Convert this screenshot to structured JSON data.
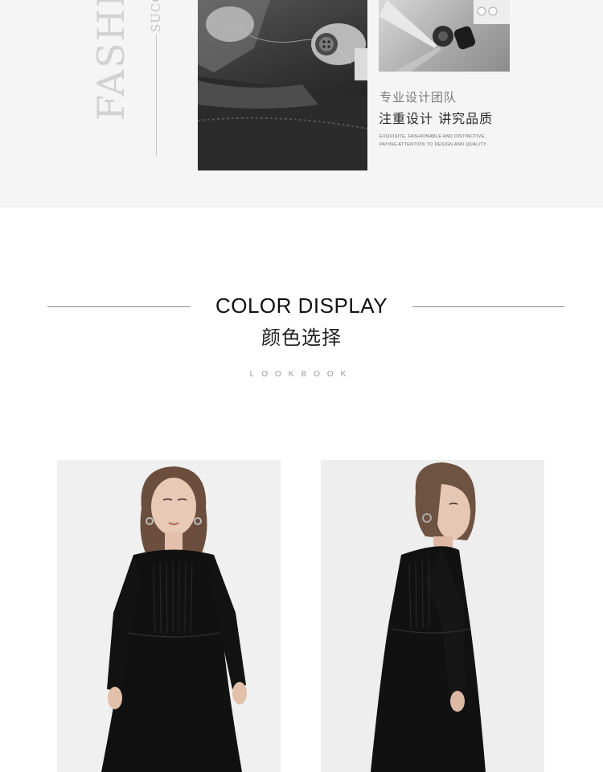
{
  "banner": {
    "vertical_text_large": "FASHION",
    "vertical_text_small": "SUCCESS",
    "photos": [
      {
        "subject": "hands-sewing-photo"
      },
      {
        "subject": "scissors-buttons-thread-photo"
      }
    ],
    "team_subtitle": "专业设计团队",
    "team_slogan": "注重设计 讲究品质",
    "team_english": "EXQUISITE, FASHIONABLE AND DISTINCTIVE, PAYING ATTENTION TO DESIGN AND QUALITY."
  },
  "color_display": {
    "title": "COLOR DISPLAY",
    "subtitle": "颜色选择",
    "tagline": "LOOKBOOK"
  },
  "products": [
    {
      "view": "front",
      "dress_color": "#111111"
    },
    {
      "view": "side",
      "dress_color": "#111111"
    }
  ]
}
